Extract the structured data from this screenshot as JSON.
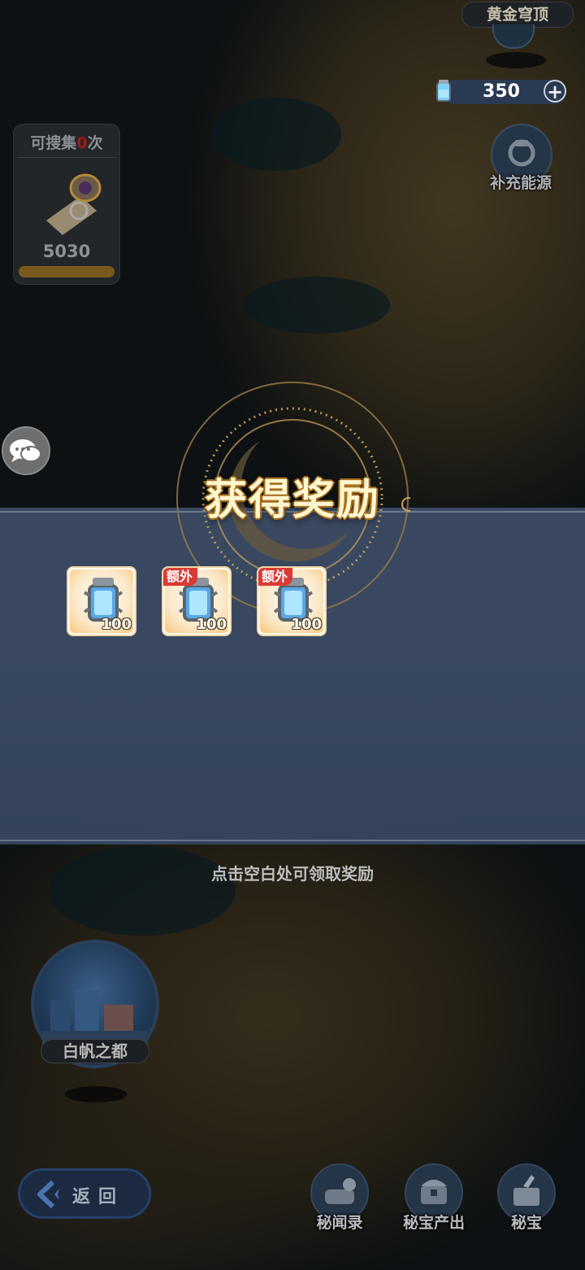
{
  "top_location": {
    "label": "黄金穹顶"
  },
  "energy": {
    "value": "350",
    "plus_label": "+"
  },
  "refill": {
    "label": "补充能源"
  },
  "search_panel": {
    "prefix": "可搜集",
    "count": "0",
    "suffix": "次",
    "value": "5030"
  },
  "reward": {
    "title": "获得奖励",
    "items": [
      {
        "quantity": "100",
        "extra_label": ""
      },
      {
        "quantity": "100",
        "extra_label": "额外"
      },
      {
        "quantity": "100",
        "extra_label": "额外"
      }
    ],
    "hint": "点击空白处可领取奖励"
  },
  "city": {
    "label": "白帆之都"
  },
  "back": {
    "label": "返回"
  },
  "bottom_buttons": [
    {
      "label": "秘闻录"
    },
    {
      "label": "秘宝产出"
    },
    {
      "label": "秘宝"
    }
  ],
  "colors": {
    "accent_gold": "#b67a22",
    "extra_badge": "#d93a36",
    "band": "#3a4963"
  }
}
